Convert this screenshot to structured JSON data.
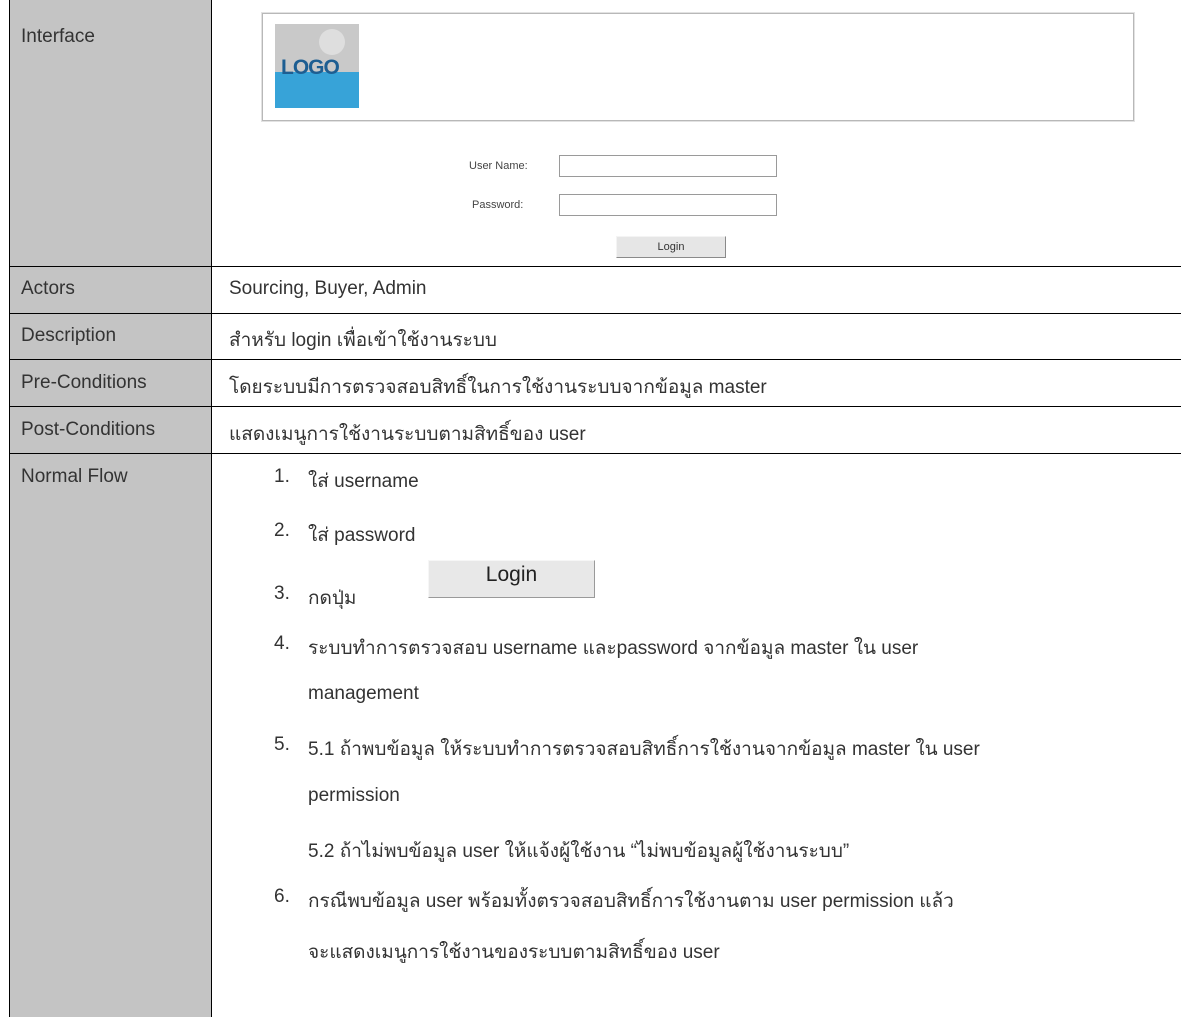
{
  "rows": {
    "interface": {
      "label": "Interface"
    },
    "actors": {
      "label": "Actors",
      "value": "Sourcing, Buyer, Admin"
    },
    "description": {
      "label": "Description",
      "value": "สำหรับ login เพื่อเข้าใช้งานระบบ"
    },
    "preconditions": {
      "label": "Pre-Conditions",
      "value": "โดยระบบมีการตรวจสอบสิทธิ์ในการใช้งานระบบจากข้อมูล master"
    },
    "postconditions": {
      "label": "Post-Conditions",
      "value": "แสดงเมนูการใช้งานระบบตามสิทธิ์ของ user"
    },
    "normalflow": {
      "label": "Normal Flow"
    }
  },
  "mockup": {
    "logo_text": "LOGO",
    "username_label": "User Name:",
    "password_label": "Password:",
    "login_button": "Login"
  },
  "flow": {
    "s1_num": "1.",
    "s1_text": "ใส่ username",
    "s2_num": "2.",
    "s2_text": "ใส่ password",
    "s3_num": "3.",
    "s3_text": "กดปุ่ม",
    "s3_button": "Login",
    "s4_num": "4.",
    "s4_text_l1": "ระบบทำการตรวจสอบ username และpassword จากข้อมูล master ใน user",
    "s4_text_l2": "management",
    "s5_num": "5.",
    "s5_text_l1": "5.1 ถ้าพบข้อมูล ให้ระบบทำการตรวจสอบสิทธิ์การใช้งานจากข้อมูล master ใน user",
    "s5_text_l2": "permission",
    "s5_text_l3": "5.2  ถ้าไม่พบข้อมูล user ให้แจ้งผู้ใช้งาน “ไม่พบข้อมูลผู้ใช้งานระบบ”",
    "s6_num": "6.",
    "s6_text_l1": "กรณีพบข้อมูล user พร้อมทั้งตรวจสอบสิทธิ์การใช้งานตาม user permission แล้ว",
    "s6_text_l2": "จะแสดงเมนูการใช้งานของระบบตามสิทธิ์ของ user"
  }
}
